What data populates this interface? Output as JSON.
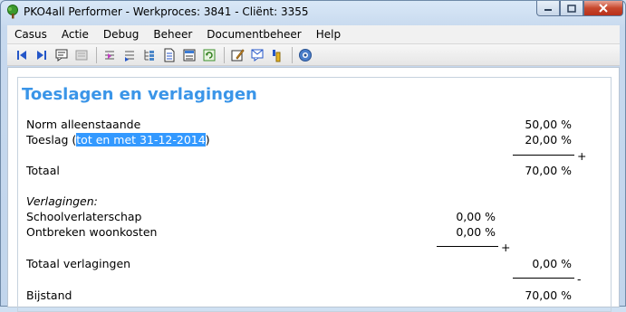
{
  "window": {
    "title": "PKO4all Performer - Werkproces: 3841 - Cliënt: 3355"
  },
  "menu": {
    "items": [
      "Casus",
      "Actie",
      "Debug",
      "Beheer",
      "Documentbeheer",
      "Help"
    ]
  },
  "toolbar": {
    "icons": [
      "first-record-icon",
      "last-record-icon",
      "comment-icon",
      "grayed-doc-icon",
      "step-into-icon",
      "step-over-icon",
      "tree-icon",
      "document-icon",
      "list-icon",
      "refresh-icon",
      "edit-icon",
      "message-icon",
      "tools-icon",
      "help-icon"
    ]
  },
  "page": {
    "heading": "Toeslagen en verlagingen",
    "norm_label": "Norm alleenstaande",
    "norm_value": "50,00 %",
    "toeslag_label_prefix": "Toeslag (",
    "toeslag_label_selected": "tot en met 31-12-2014",
    "toeslag_label_suffix": ")",
    "toeslag_value": "20,00 %",
    "plus1": "+",
    "totaal_label": "Totaal",
    "totaal_value": "70,00 %",
    "verlagingen_label": "Verlagingen:",
    "school_label": "Schoolverlaterschap",
    "school_value": "0,00 %",
    "woon_label": "Ontbreken woonkosten",
    "woon_value": "0,00 %",
    "plus2": "+",
    "totaal_verl_label": "Totaal verlagingen",
    "totaal_verl_value": "0,00 %",
    "minus": "-",
    "bijstand_label": "Bijstand",
    "bijstand_value": "70,00 %"
  },
  "colors": {
    "heading": "#3a95e8",
    "selection": "#3399ff"
  }
}
